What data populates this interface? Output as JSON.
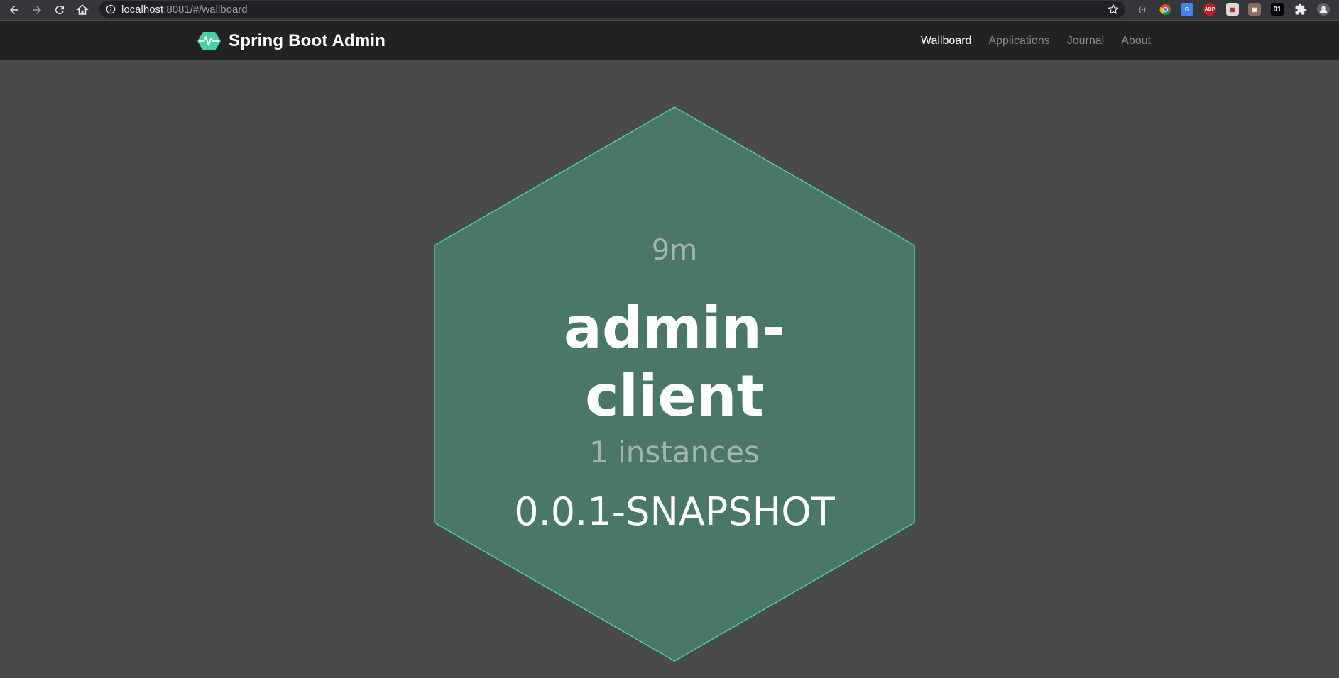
{
  "browser": {
    "url_host": "localhost",
    "url_path": ":8081/#/wallboard",
    "extension_abp_label": "ABP",
    "extension_01_label": "01"
  },
  "header": {
    "brand_title": "Spring Boot Admin",
    "nav": [
      {
        "label": "Wallboard",
        "active": true
      },
      {
        "label": "Applications",
        "active": false
      },
      {
        "label": "Journal",
        "active": false
      },
      {
        "label": "About",
        "active": false
      }
    ]
  },
  "wallboard": {
    "apps": [
      {
        "uptime": "9m",
        "name": "admin-client",
        "instances": "1 instances",
        "version": "0.0.1-SNAPSHOT",
        "status_color": "#4a7868",
        "border_color": "#42d3a5"
      }
    ]
  },
  "colors": {
    "background": "#4a4a4a",
    "navbar": "#222222",
    "brand_accent": "#42d3a5"
  }
}
